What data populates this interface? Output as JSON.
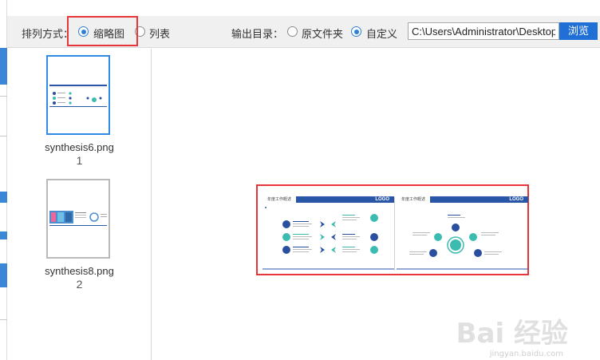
{
  "toolbar": {
    "sort_label": "排列方式：",
    "sort_options": [
      {
        "label": "缩略图",
        "checked": true
      },
      {
        "label": "列表",
        "checked": false
      }
    ],
    "output_label": "输出目录：",
    "output_options": [
      {
        "label": "原文件夹",
        "checked": false
      },
      {
        "label": "自定义",
        "checked": true
      }
    ],
    "path_value": "C:\\Users\\Administrator\\Desktop",
    "browse_label": "浏览"
  },
  "thumbnails": [
    {
      "name": "synthesis6.png",
      "index": "1",
      "selected": true
    },
    {
      "name": "synthesis8.png",
      "index": "2",
      "selected": false
    }
  ],
  "preview": {
    "left_slide": {
      "title": "年度工作概述",
      "logo": "LOGO"
    },
    "right_slide": {
      "title": "年度工作概述",
      "logo": "LOGO"
    }
  },
  "watermark": {
    "text": "Bai 经验",
    "url": "jingyan.baidu.com"
  },
  "colors": {
    "accent": "#2f7fd8",
    "highlight": "#e8353a",
    "button": "#1f6fd6",
    "slide_bar": "#2a56a8",
    "teal": "#3cbcb0",
    "navy": "#2a4f9e"
  }
}
